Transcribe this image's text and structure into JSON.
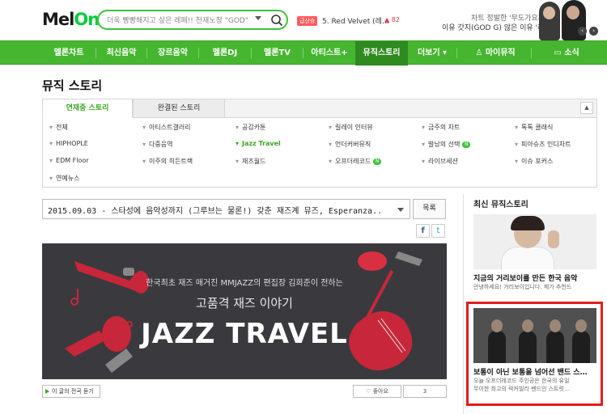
{
  "header": {
    "logo": "Mel",
    "logo_accent": "On",
    "search_placeholder": "더욱 빵빵해지고 싶은 레페!! 천재노창 \"GOD\"",
    "rank_badge": "급상승",
    "rank_item": "5. Red Velvet (레…",
    "rank_change": "▲ 82",
    "banner_line1": "차트 정발한 '무도가요제'",
    "banner_line2": "이유 갓지(GOD G) 않은 이유 '레옹'",
    "carousel_prev": "‹",
    "carousel_next": "›"
  },
  "nav": {
    "items": [
      "멜론차트",
      "최신음악",
      "장르음악",
      "멜론DJ",
      "멜론TV",
      "아티스트+",
      "뮤직스토리",
      "더보기 ▾",
      "마이뮤직",
      "소식"
    ],
    "active_index": 6
  },
  "page": {
    "title": "뮤직 스토리"
  },
  "tabs": {
    "items": [
      "연재중 스토리",
      "완결된 스토리"
    ],
    "active_index": 0,
    "collapse_icon": "▲"
  },
  "categories": [
    [
      "전체",
      "아티스트갤러리",
      "공감카툰",
      "릴레이 인터뷰",
      "금주의 차트",
      "톡톡 클래식"
    ],
    [
      "HIPHOPLE",
      "다중음역",
      "Jazz Travel",
      "언더커버뮤직",
      "발남의 선택",
      "피아슈즈 인디차트"
    ],
    [
      "EDM Floor",
      "이주의 히든트랙",
      "재즈월드",
      "오프더레코드",
      "라이브세션",
      "이슈 포커스"
    ],
    [
      "연예뉴스"
    ]
  ],
  "new_badge": "N",
  "category_active": "Jazz Travel",
  "article": {
    "selected": "2015.09.03 - 스타성에 음악성까지 (그루브는 물론!) 갖춘 재즈계 뮤즈, Esperanza..",
    "list_button": "목록",
    "facebook": "f",
    "twitter": "t",
    "hero_line1": "한국최초 재즈 매거진 MMJAZZ의 편집장 김희준이 전하는",
    "hero_line2": "고품격 재즈 이야기",
    "hero_title": "JAZZ TRAVEL",
    "listen_label": "이 글의 전곡 듣기",
    "like_label": "♡ 좋아요",
    "like_count": "3"
  },
  "sidebar": {
    "title": "최신 뮤직스토리",
    "items": [
      {
        "title": "지금의 거리보이를 만든 한국 음악",
        "desc": [
          "안녕하세요! 거리보이입니다. 제가 추천드"
        ]
      },
      {
        "title": "보통이 아닌 보통을 넘어선 밴드 스…",
        "desc": [
          "오늘 오프더레코드 주인공은 한국의 유일",
          "무이한 최고의 락커빌리 밴드인 스트럿…"
        ]
      }
    ]
  },
  "colors": {
    "brand_green": "#46b630",
    "highlight_red": "#e21d1d"
  }
}
